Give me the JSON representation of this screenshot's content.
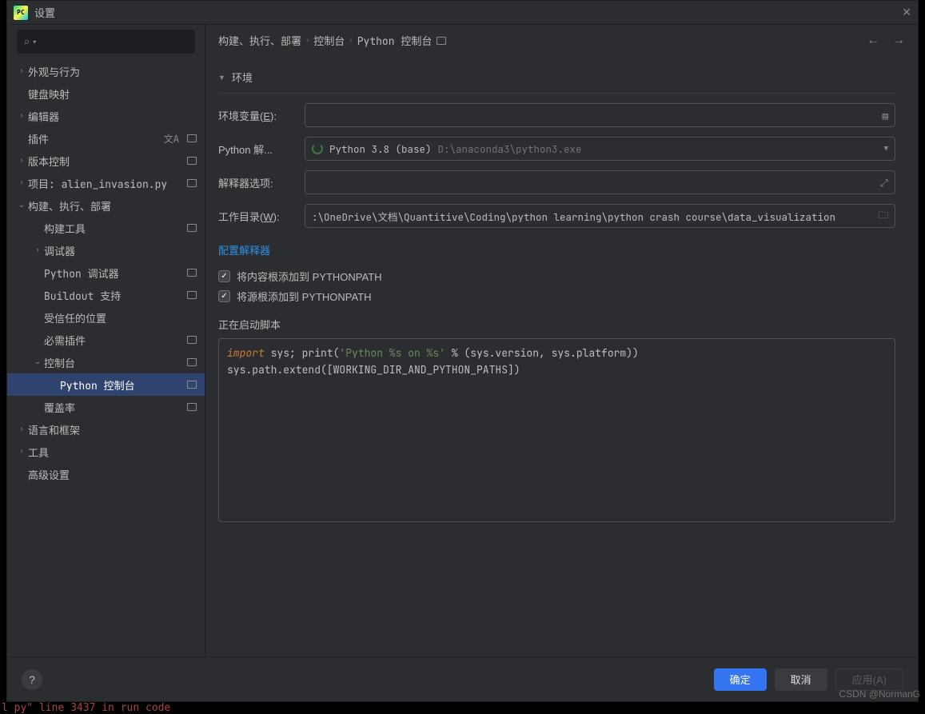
{
  "window": {
    "title": "设置",
    "logo_text": "PC"
  },
  "sidebar": {
    "items": [
      {
        "label": "外观与行为",
        "indent": 0,
        "expandable": true,
        "expanded": false
      },
      {
        "label": "键盘映射",
        "indent": 0,
        "expandable": false
      },
      {
        "label": "编辑器",
        "indent": 0,
        "expandable": true,
        "expanded": false
      },
      {
        "label": "插件",
        "indent": 0,
        "expandable": false,
        "lang_icon": true,
        "badge": true
      },
      {
        "label": "版本控制",
        "indent": 0,
        "expandable": true,
        "expanded": false,
        "badge": true
      },
      {
        "label": "项目: alien_invasion.py",
        "indent": 0,
        "expandable": true,
        "expanded": false,
        "badge": true,
        "mono": true
      },
      {
        "label": "构建、执行、部署",
        "indent": 0,
        "expandable": true,
        "expanded": true
      },
      {
        "label": "构建工具",
        "indent": 1,
        "expandable": false,
        "badge": true
      },
      {
        "label": "调试器",
        "indent": 1,
        "expandable": true,
        "expanded": false
      },
      {
        "label": "Python 调试器",
        "indent": 1,
        "expandable": false,
        "badge": true,
        "mono": true
      },
      {
        "label": "Buildout 支持",
        "indent": 1,
        "expandable": false,
        "badge": true,
        "mono": true
      },
      {
        "label": "受信任的位置",
        "indent": 1,
        "expandable": false
      },
      {
        "label": "必需插件",
        "indent": 1,
        "expandable": false,
        "badge": true
      },
      {
        "label": "控制台",
        "indent": 1,
        "expandable": true,
        "expanded": true,
        "badge": true
      },
      {
        "label": "Python 控制台",
        "indent": 2,
        "expandable": false,
        "badge": true,
        "selected": true,
        "mono": true
      },
      {
        "label": "覆盖率",
        "indent": 1,
        "expandable": false,
        "badge": true
      },
      {
        "label": "语言和框架",
        "indent": 0,
        "expandable": true,
        "expanded": false
      },
      {
        "label": "工具",
        "indent": 0,
        "expandable": true,
        "expanded": false
      },
      {
        "label": "高级设置",
        "indent": 0,
        "expandable": false
      }
    ]
  },
  "breadcrumbs": {
    "c0": "构建、执行、部署",
    "c1": "控制台",
    "c2": "Python 控制台"
  },
  "section": {
    "env_title": "环境",
    "env_vars_label_pre": "环境变量(",
    "env_vars_label_u": "E",
    "env_vars_label_post": "):",
    "interpreter_label": "Python 解...",
    "interpreter_name": "Python 3.8 (base)",
    "interpreter_path": "D:\\anaconda3\\python3.exe",
    "interp_opts_label": "解释器选项:",
    "workdir_label_pre": "工作目录(",
    "workdir_label_u": "W",
    "workdir_label_post": "):",
    "workdir_value": ":\\OneDrive\\文档\\Quantitive\\Coding\\python learning\\python crash course\\data_visualization",
    "config_link": "配置解释器",
    "check1": "将内容根添加到 PYTHONPATH",
    "check2": "将源根添加到 PYTHONPATH",
    "startup_label": "正在启动脚本"
  },
  "script": {
    "kw": "import",
    "rest1": " sys; print(",
    "str": "'Python %s on %s'",
    "rest2": " % (sys.version, sys.platform))",
    "line2": "sys.path.extend([WORKING_DIR_AND_PYTHON_PATHS])"
  },
  "footer": {
    "ok": "确定",
    "cancel": "取消",
    "apply": "应用(A)"
  },
  "watermark": "CSDN @NormanG",
  "bg_err": "l py\"  line 3437  in run code"
}
